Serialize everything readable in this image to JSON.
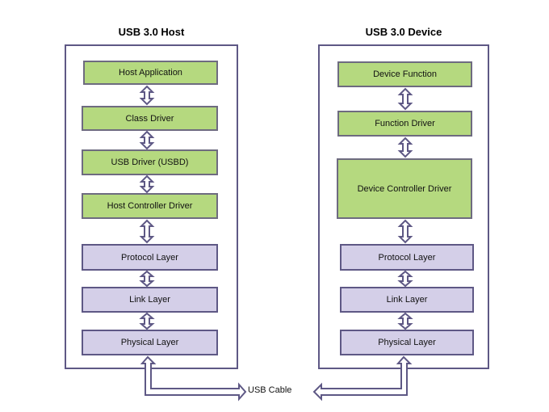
{
  "host": {
    "title": "USB 3.0 Host",
    "layers": [
      {
        "label": "Host Application",
        "kind": "software"
      },
      {
        "label": "Class Driver",
        "kind": "software"
      },
      {
        "label": "USB Driver (USBD)",
        "kind": "software"
      },
      {
        "label": "Host Controller Driver",
        "kind": "software"
      },
      {
        "label": "Protocol Layer",
        "kind": "hardware"
      },
      {
        "label": "Link Layer",
        "kind": "hardware"
      },
      {
        "label": "Physical Layer",
        "kind": "hardware"
      }
    ]
  },
  "device": {
    "title": "USB 3.0 Device",
    "layers": [
      {
        "label": "Device Function",
        "kind": "software"
      },
      {
        "label": "Function Driver",
        "kind": "software"
      },
      {
        "label": "Device Controller Driver",
        "kind": "software"
      },
      {
        "label": "Protocol Layer",
        "kind": "hardware"
      },
      {
        "label": "Link Layer",
        "kind": "hardware"
      },
      {
        "label": "Physical Layer",
        "kind": "hardware"
      }
    ]
  },
  "cable": {
    "label": "USB Cable"
  },
  "colors": {
    "software": "#b5d97f",
    "hardware": "#d4cfe8",
    "outline": "#5e5885"
  }
}
